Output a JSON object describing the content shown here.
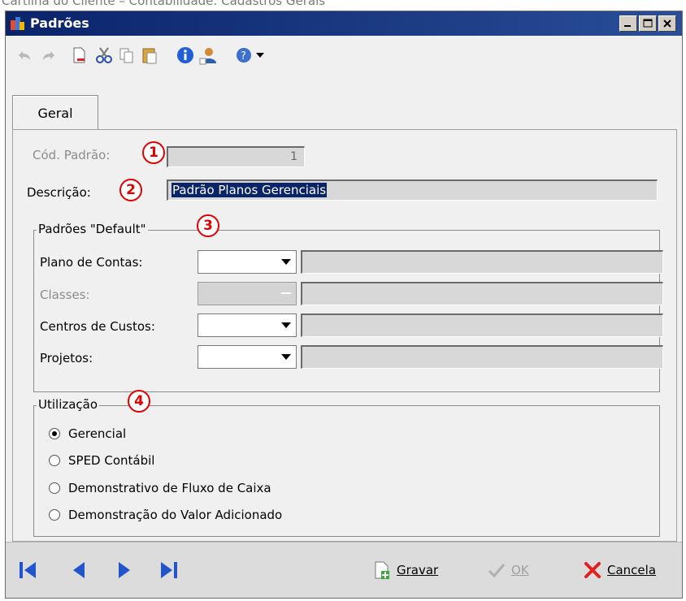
{
  "caption": "Cartilha do Cliente – Contabilidade: Cadastros Gerais",
  "window": {
    "title": "Padrões"
  },
  "tabs": [
    {
      "label": "Geral"
    }
  ],
  "fields": {
    "cod_padrao": {
      "label": "Cód. Padrão:",
      "value": "1",
      "marker": "1"
    },
    "descricao": {
      "label": "Descrição:",
      "value": "Padrão Planos Gerenciais",
      "marker": "2"
    }
  },
  "defaults_group": {
    "title": "Padrões \"Default\"",
    "marker": "3",
    "rows": [
      {
        "label": "Plano de Contas:",
        "enabled": true
      },
      {
        "label": "Classes:",
        "enabled": false
      },
      {
        "label": "Centros de Custos:",
        "enabled": true
      },
      {
        "label": "Projetos:",
        "enabled": true
      }
    ]
  },
  "usage_group": {
    "title": "Utilização",
    "marker": "4",
    "options": [
      {
        "label": "Gerencial",
        "selected": true
      },
      {
        "label": "SPED Contábil",
        "selected": false
      },
      {
        "label": "Demonstrativo de Fluxo de Caixa",
        "selected": false
      },
      {
        "label": "Demonstração do Valor Adicionado",
        "selected": false
      }
    ]
  },
  "footer": {
    "gravar": "Gravar",
    "ok": "OK",
    "cancela": "Cancela"
  },
  "colors": {
    "titlebar": "#0a246a",
    "marker_red": "#e00000",
    "selection": "#0a246a",
    "nav_blue": "#2255cc"
  },
  "icons": {
    "toolbar": [
      "undo-icon",
      "redo-icon",
      "new-document-icon",
      "cut-icon",
      "copy-icon",
      "paste-icon",
      "info-icon",
      "user-icon",
      "help-icon",
      "dropdown-arrow-icon"
    ],
    "nav": [
      "first-record-icon",
      "previous-record-icon",
      "next-record-icon",
      "last-record-icon"
    ]
  }
}
